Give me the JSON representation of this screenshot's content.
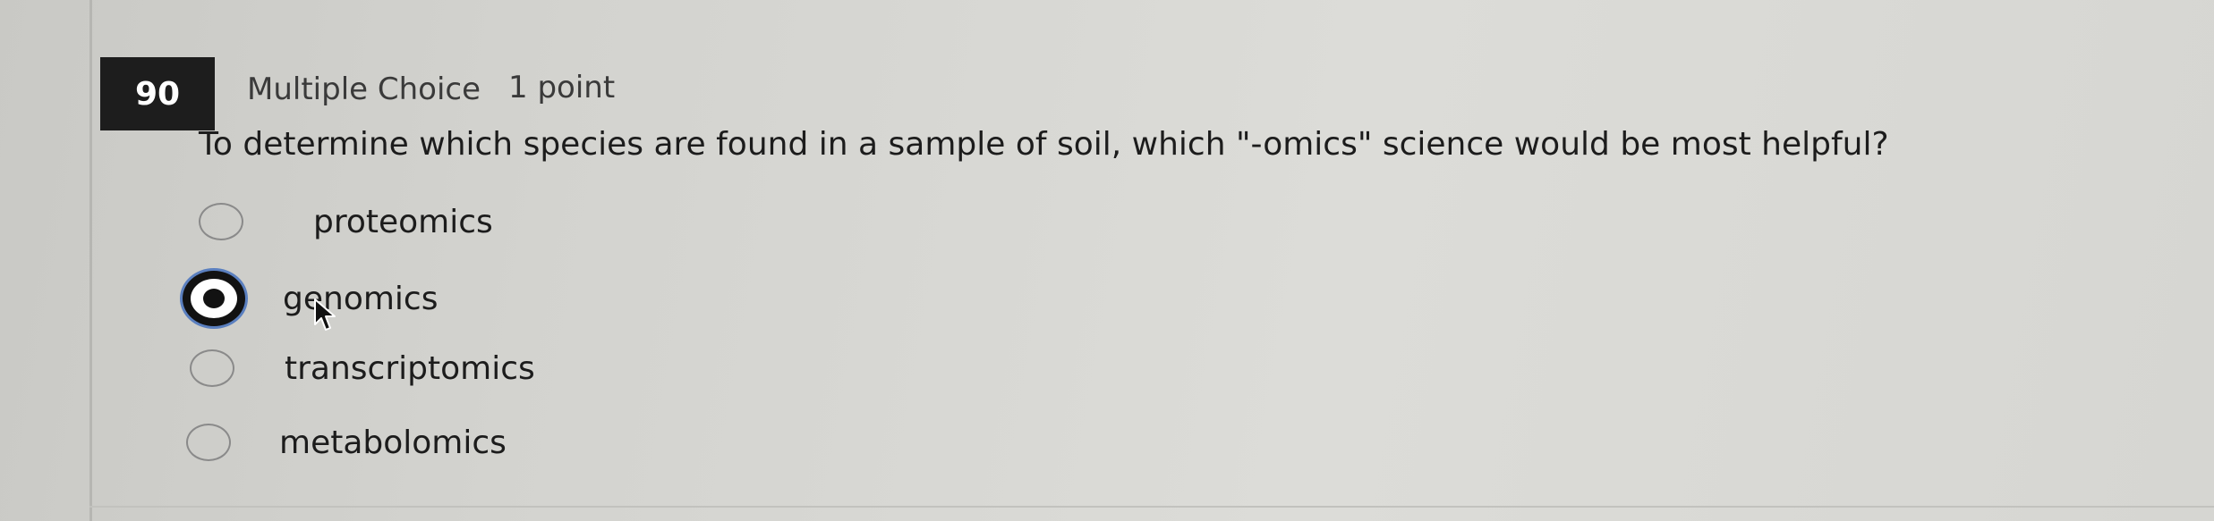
{
  "question": {
    "number": "90",
    "type": "Multiple Choice",
    "points": "1 point",
    "text": "To determine which species are found in a sample of soil, which \"-omics\" science would be most helpful?"
  },
  "options": [
    {
      "label": "proteomics",
      "selected": false
    },
    {
      "label": "genomics",
      "selected": true
    },
    {
      "label": "transcriptomics",
      "selected": false
    },
    {
      "label": "metabolomics",
      "selected": false
    }
  ]
}
